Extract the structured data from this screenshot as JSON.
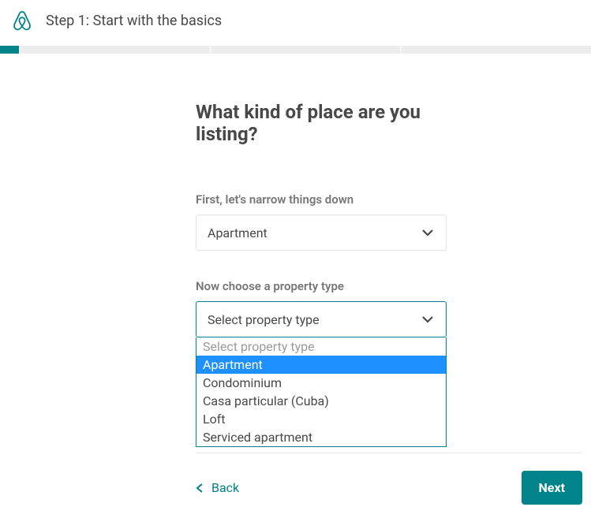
{
  "header": {
    "step_title": "Step 1: Start with the basics"
  },
  "main": {
    "heading": "What kind of place are you listing?",
    "field1": {
      "label": "First, let's narrow things down",
      "selected": "Apartment"
    },
    "field2": {
      "label": "Now choose a property type",
      "selected": "Select property type",
      "options": [
        "Select property type",
        "Apartment",
        "Condominium",
        "Casa particular (Cuba)",
        "Loft",
        "Serviced apartment"
      ]
    }
  },
  "footer": {
    "back": "Back",
    "next": "Next"
  }
}
